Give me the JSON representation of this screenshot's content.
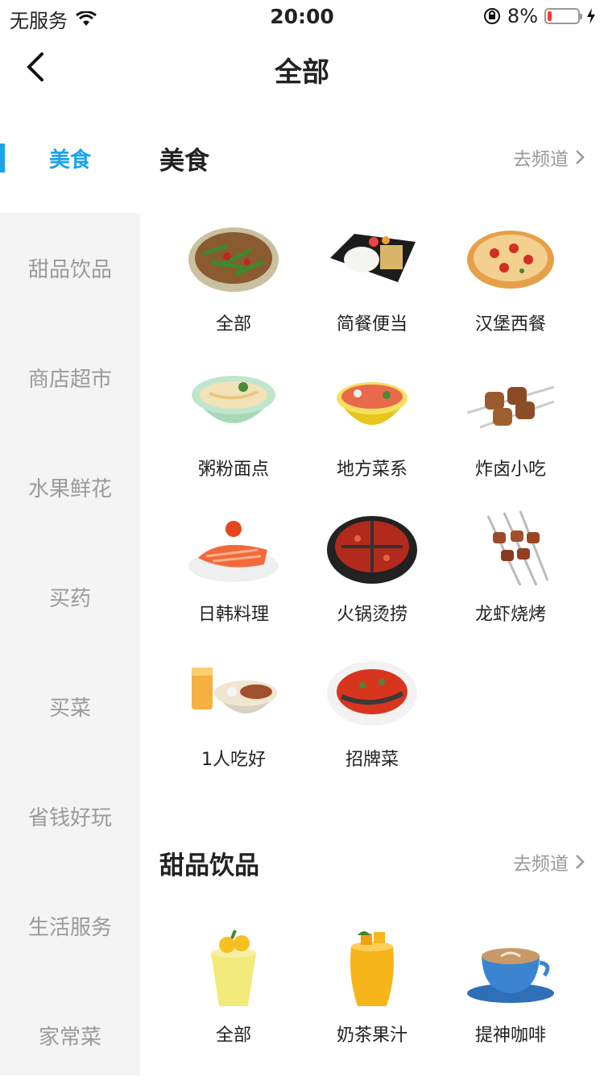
{
  "status_bar": {
    "carrier": "无服务",
    "time": "20:00",
    "battery": "8%"
  },
  "nav": {
    "title": "全部"
  },
  "sidebar": {
    "items": [
      "美食",
      "甜品饮品",
      "商店超市",
      "水果鲜花",
      "买药",
      "买菜",
      "省钱好玩",
      "生活服务",
      "家常菜"
    ]
  },
  "sections": [
    {
      "title": "美食",
      "link": "去频道",
      "items": [
        "全部",
        "简餐便当",
        "汉堡西餐",
        "粥粉面点",
        "地方菜系",
        "炸卤小吃",
        "日韩料理",
        "火锅烫捞",
        "龙虾烧烤",
        "1人吃好",
        "招牌菜"
      ]
    },
    {
      "title": "甜品饮品",
      "link": "去频道",
      "items": [
        "全部",
        "奶茶果汁",
        "提神咖啡"
      ]
    }
  ],
  "colors": {
    "accent": "#1aa3ea",
    "sidebar_bg": "#f4f4f4",
    "muted": "#9a9a9a"
  }
}
